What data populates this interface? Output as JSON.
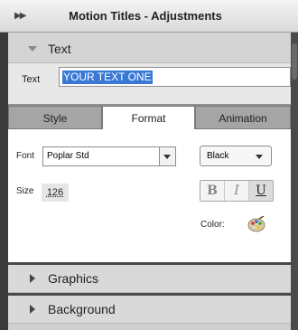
{
  "panel": {
    "title": "Motion Titles - Adjustments"
  },
  "sections": {
    "text": {
      "label": "Text",
      "field_label": "Text",
      "field_value": "YOUR TEXT ONE"
    },
    "graphics": {
      "label": "Graphics"
    },
    "background": {
      "label": "Background"
    }
  },
  "tabs": [
    {
      "label": "Style",
      "active": false
    },
    {
      "label": "Format",
      "active": true
    },
    {
      "label": "Animation",
      "active": false
    }
  ],
  "format": {
    "font_label": "Font",
    "font_value": "Poplar Std",
    "style_value": "Black",
    "size_label": "Size",
    "size_value": "126",
    "bold_label": "B",
    "italic_label": "I",
    "underline_label": "U",
    "color_label": "Color:"
  },
  "icons": {
    "collapse": "double-chevron-right-icon",
    "palette": "color-palette-icon"
  }
}
